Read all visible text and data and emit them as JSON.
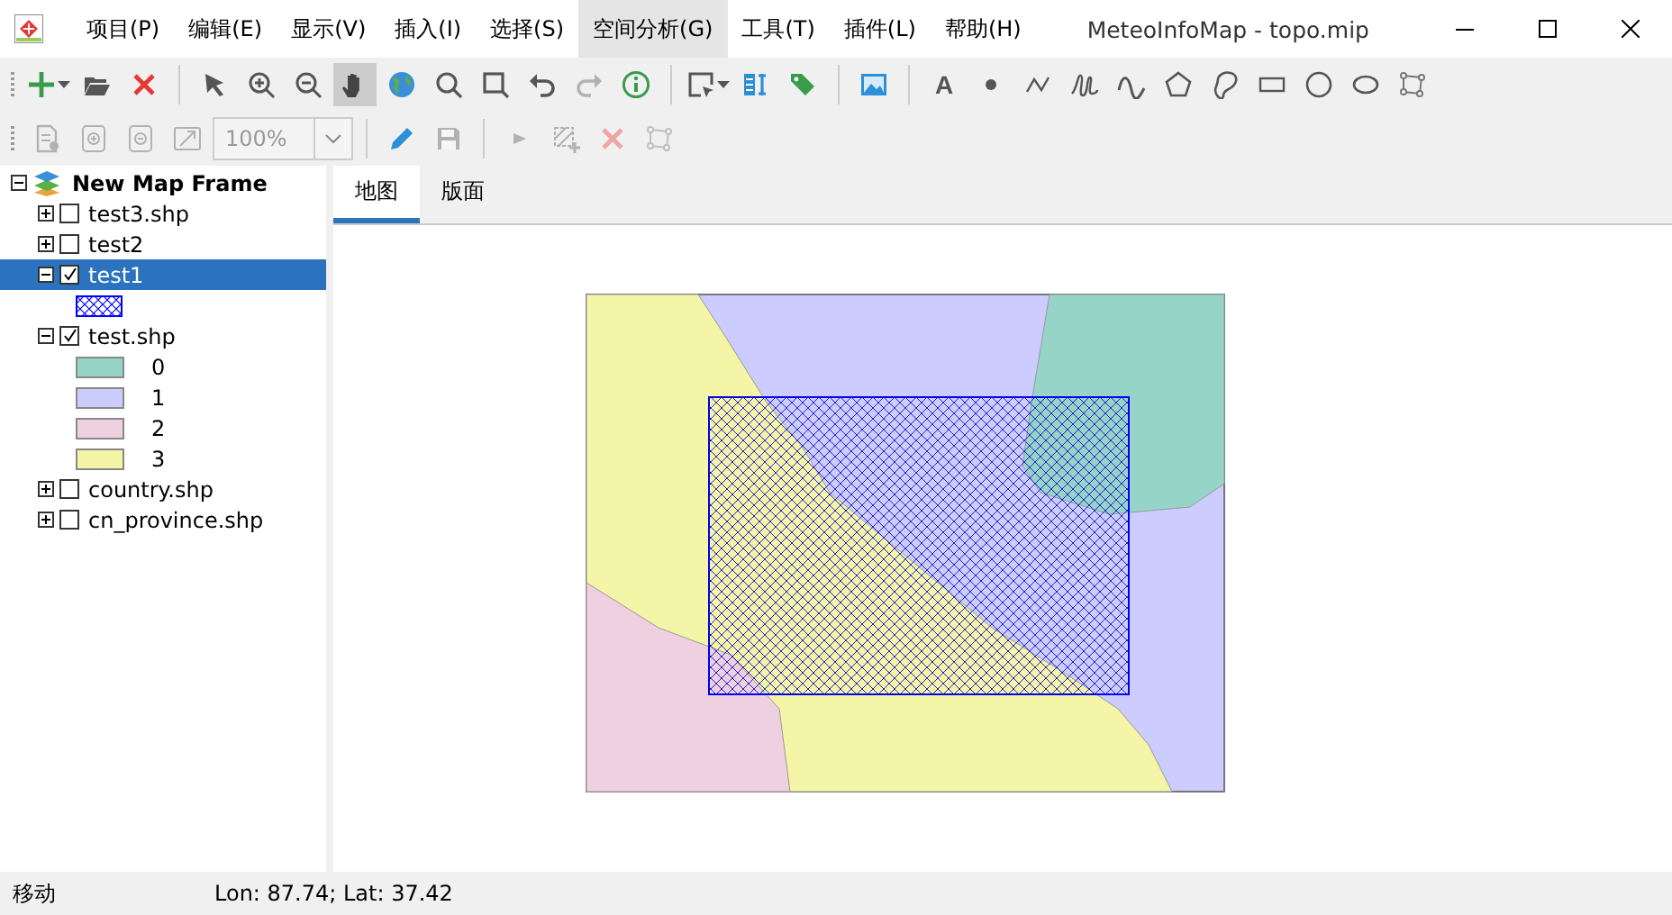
{
  "window": {
    "title": "MeteoInfoMap - topo.mip"
  },
  "menu": [
    {
      "label": "项目(P)",
      "selected": false
    },
    {
      "label": "编辑(E)",
      "selected": false
    },
    {
      "label": "显示(V)",
      "selected": false
    },
    {
      "label": "插入(I)",
      "selected": false
    },
    {
      "label": "选择(S)",
      "selected": false
    },
    {
      "label": "空间分析(G)",
      "selected": true
    },
    {
      "label": "工具(T)",
      "selected": false
    },
    {
      "label": "插件(L)",
      "selected": false
    },
    {
      "label": "帮助(H)",
      "selected": false
    }
  ],
  "toolbar_1": [
    {
      "kind": "add",
      "dropdown": true,
      "selected": false,
      "disabled": false
    },
    {
      "kind": "open",
      "dropdown": false,
      "selected": false,
      "disabled": false
    },
    {
      "kind": "delete",
      "dropdown": false,
      "selected": false,
      "disabled": false
    },
    {
      "kind": "separator"
    },
    {
      "kind": "pointer",
      "dropdown": false,
      "selected": false,
      "disabled": false
    },
    {
      "kind": "zoomin",
      "dropdown": false,
      "selected": false,
      "disabled": false
    },
    {
      "kind": "zoomout",
      "dropdown": false,
      "selected": false,
      "disabled": false
    },
    {
      "kind": "pan",
      "dropdown": false,
      "selected": true,
      "disabled": false
    },
    {
      "kind": "globe",
      "dropdown": false,
      "selected": false,
      "disabled": false
    },
    {
      "kind": "search",
      "dropdown": false,
      "selected": false,
      "disabled": false
    },
    {
      "kind": "square",
      "dropdown": false,
      "selected": false,
      "disabled": false
    },
    {
      "kind": "undo",
      "dropdown": false,
      "selected": false,
      "disabled": false
    },
    {
      "kind": "redo",
      "dropdown": false,
      "selected": false,
      "disabled": true
    },
    {
      "kind": "info",
      "dropdown": false,
      "selected": false,
      "disabled": false
    },
    {
      "kind": "separator"
    },
    {
      "kind": "selectbox",
      "dropdown": true,
      "selected": false,
      "disabled": false
    },
    {
      "kind": "columns",
      "dropdown": false,
      "selected": false,
      "disabled": false
    },
    {
      "kind": "tag",
      "dropdown": false,
      "selected": false,
      "disabled": false
    },
    {
      "kind": "separator"
    },
    {
      "kind": "image",
      "dropdown": false,
      "selected": false,
      "disabled": false
    },
    {
      "kind": "separator"
    },
    {
      "kind": "text",
      "label": "A",
      "dropdown": false,
      "selected": false,
      "disabled": false
    },
    {
      "kind": "point",
      "dropdown": false,
      "selected": false,
      "disabled": false
    },
    {
      "kind": "polyline",
      "dropdown": false,
      "selected": false,
      "disabled": false
    },
    {
      "kind": "freehand",
      "dropdown": false,
      "selected": false,
      "disabled": false
    },
    {
      "kind": "curve",
      "dropdown": false,
      "selected": false,
      "disabled": false
    },
    {
      "kind": "polygon",
      "dropdown": false,
      "selected": false,
      "disabled": false
    },
    {
      "kind": "blob",
      "dropdown": false,
      "selected": false,
      "disabled": false
    },
    {
      "kind": "rectangle",
      "dropdown": false,
      "selected": false,
      "disabled": false
    },
    {
      "kind": "circle",
      "dropdown": false,
      "selected": false,
      "disabled": false
    },
    {
      "kind": "ellipse",
      "dropdown": false,
      "selected": false,
      "disabled": false
    },
    {
      "kind": "vertex",
      "dropdown": false,
      "selected": false,
      "disabled": false
    }
  ],
  "toolbar_2": [
    {
      "kind": "document",
      "dropdown": false,
      "selected": false,
      "disabled": true
    },
    {
      "kind": "pagezoomin",
      "dropdown": false,
      "selected": false,
      "disabled": true
    },
    {
      "kind": "pagezoomout",
      "dropdown": false,
      "selected": false,
      "disabled": true
    },
    {
      "kind": "fit",
      "dropdown": false,
      "selected": false,
      "disabled": true
    },
    {
      "kind": "zoombox",
      "value": "100%",
      "disabled": true
    },
    {
      "kind": "separator"
    },
    {
      "kind": "pencil",
      "dropdown": false,
      "selected": false,
      "disabled": false
    },
    {
      "kind": "save",
      "dropdown": false,
      "selected": false,
      "disabled": true
    },
    {
      "kind": "separator"
    },
    {
      "kind": "play",
      "dropdown": false,
      "selected": false,
      "disabled": true
    },
    {
      "kind": "addfeature",
      "dropdown": false,
      "selected": false,
      "disabled": true
    },
    {
      "kind": "delete",
      "dropdown": false,
      "selected": false,
      "disabled": true
    },
    {
      "kind": "vertex",
      "dropdown": false,
      "selected": false,
      "disabled": true
    }
  ],
  "tree": {
    "label": "New Map Frame",
    "expanded": true,
    "children": [
      {
        "label": "test3.shp",
        "checked": false,
        "expanded": false,
        "selected": false
      },
      {
        "label": "test2",
        "checked": false,
        "expanded": false,
        "selected": false
      },
      {
        "label": "test1",
        "checked": true,
        "expanded": true,
        "selected": true,
        "children": [
          {
            "kind": "hatch"
          }
        ]
      },
      {
        "label": "test.shp",
        "checked": true,
        "expanded": true,
        "selected": false,
        "children": [
          {
            "kind": "fill",
            "label": "0",
            "color": "#96d4c8"
          },
          {
            "kind": "fill",
            "label": "1",
            "color": "#ccccff"
          },
          {
            "kind": "fill",
            "label": "2",
            "color": "#eed0e0"
          },
          {
            "kind": "fill",
            "label": "3",
            "color": "#f5f5a8"
          }
        ]
      },
      {
        "label": "country.shp",
        "checked": false,
        "expanded": false,
        "selected": false
      },
      {
        "label": "cn_province.shp",
        "checked": false,
        "expanded": false,
        "selected": false
      }
    ]
  },
  "tabs": [
    {
      "label": "地图",
      "selected": true
    },
    {
      "label": "版面",
      "selected": false
    }
  ],
  "status_bar": {
    "mode": "移动",
    "coordinates": "Lon: 87.74; Lat: 37.42"
  }
}
